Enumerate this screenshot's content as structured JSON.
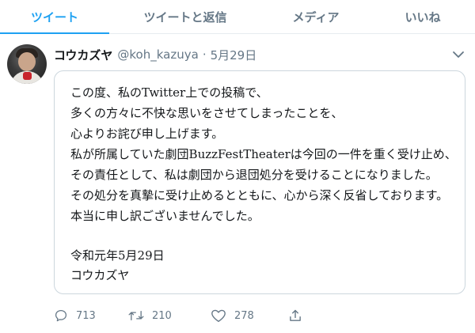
{
  "tabs": [
    {
      "label": "ツイート",
      "active": true
    },
    {
      "label": "ツイートと返信",
      "active": false
    },
    {
      "label": "メディア",
      "active": false
    },
    {
      "label": "いいね",
      "active": false
    }
  ],
  "tweet": {
    "author_name": "コウカズヤ",
    "handle": "@koh_kazuya",
    "separator": "·",
    "date": "5月29日",
    "image_lines": [
      "この度、私のTwitter上での投稿で、",
      "多くの方々に不快な思いをさせてしまったことを、",
      "心よりお詫び申し上げます。",
      "私が所属していた劇団BuzzFestTheaterは今回の一件を重く受け止め、",
      "その責任として、私は劇団から退団処分を受けることになりました。",
      "その処分を真摯に受け止めるとともに、心から深く反省しております。",
      "本当に申し訳ございませんでした。",
      "令和元年5月29日",
      "コウカズヤ"
    ],
    "replies": "713",
    "retweets": "210",
    "likes": "278"
  },
  "colors": {
    "accent": "#1da1f2",
    "muted": "#657786",
    "border": "#ccd6dd"
  },
  "icons": {
    "reply": "reply-icon",
    "retweet": "retweet-icon",
    "like": "heart-icon",
    "share": "share-icon",
    "menu": "chevron-down-icon"
  }
}
